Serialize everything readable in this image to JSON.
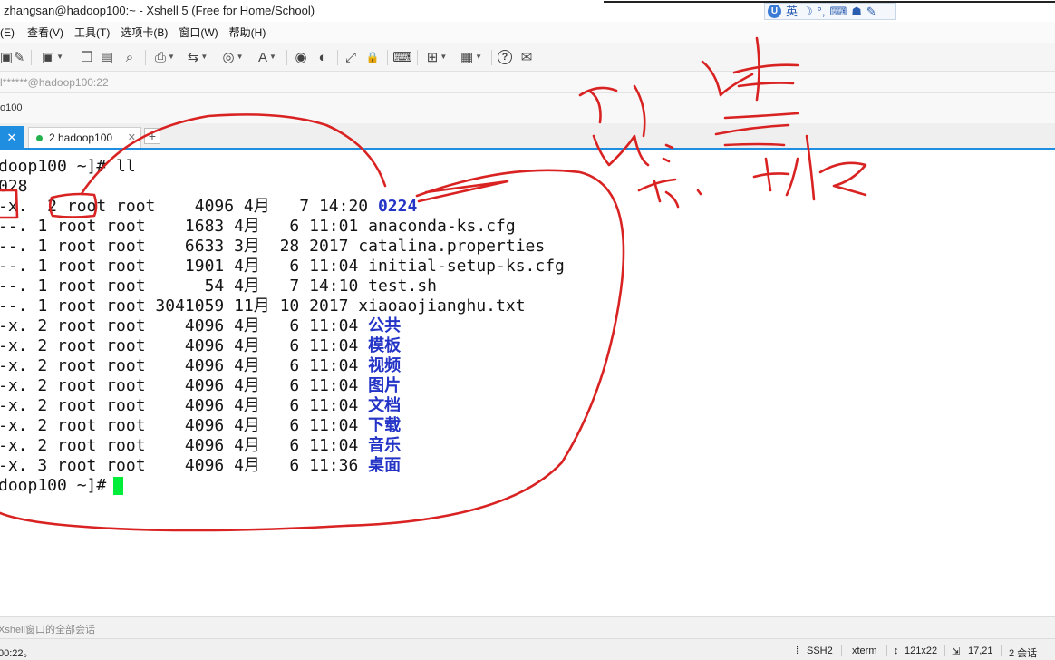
{
  "window": {
    "title": "zhangsan@hadoop100:~ - Xshell 5 (Free for Home/School)"
  },
  "ime": {
    "badge": "U",
    "lang": "英",
    "moon": "☽",
    "punct": "°,",
    "keyboard": "⌨",
    "user": "☗",
    "tools": "✎"
  },
  "menu": {
    "items": [
      "(E)",
      "查看(V)",
      "工具(T)",
      "选项卡(B)",
      "窗口(W)",
      "帮助(H)"
    ]
  },
  "toolbar": {
    "icons": [
      {
        "name": "new-session-icon",
        "glyph": "▣"
      },
      {
        "name": "properties-icon",
        "glyph": "✎"
      },
      {
        "name": "copy-icon",
        "glyph": "❐"
      },
      {
        "name": "paste-icon",
        "glyph": "▤"
      },
      {
        "name": "find-icon",
        "glyph": "⌕"
      },
      {
        "name": "print-icon",
        "glyph": "⎙"
      },
      {
        "name": "transfer-icon",
        "glyph": "⇆"
      },
      {
        "name": "globe-icon",
        "glyph": "◎"
      },
      {
        "name": "font-icon",
        "glyph": "A"
      },
      {
        "name": "xftp-icon",
        "glyph": "◉"
      },
      {
        "name": "xmanager-icon",
        "glyph": "◐"
      },
      {
        "name": "fullscreen-icon",
        "glyph": "⤢"
      },
      {
        "name": "lock-icon",
        "glyph": "🔒"
      },
      {
        "name": "keyboard-icon",
        "glyph": "⌨"
      },
      {
        "name": "new-tab-icon",
        "glyph": "⊞"
      },
      {
        "name": "layout-icon",
        "glyph": "▦"
      },
      {
        "name": "help-icon",
        "glyph": "?"
      },
      {
        "name": "chat-icon",
        "glyph": "✉"
      }
    ]
  },
  "address": {
    "text": "l******@hadoop100:22"
  },
  "session_bar": {
    "label": "o100"
  },
  "tabs": {
    "close_glyph": "✕",
    "session_label": "2 hadoop100",
    "session_close": "✕",
    "add_glyph": "+"
  },
  "terminal": {
    "lines": [
      {
        "text": "doop100 ~]# ll"
      },
      {
        "text": "028"
      },
      {
        "text": "-x.  2 root root    4096 4月   7 14:20 ",
        "name": "0224",
        "dir": true
      },
      {
        "text": "--. 1 root root    1683 4月   6 11:01 ",
        "name": "anaconda-ks.cfg",
        "dir": false
      },
      {
        "text": "--. 1 root root    6633 3月  28 2017 ",
        "name": "catalina.properties",
        "dir": false
      },
      {
        "text": "--. 1 root root    1901 4月   6 11:04 ",
        "name": "initial-setup-ks.cfg",
        "dir": false
      },
      {
        "text": "--. 1 root root      54 4月   7 14:10 ",
        "name": "test.sh",
        "dir": false
      },
      {
        "text": "--. 1 root root 3041059 11月 10 2017 ",
        "name": "xiaoaojianghu.txt",
        "dir": false
      },
      {
        "text": "-x. 2 root root    4096 4月   6 11:04 ",
        "name": "公共",
        "dir": true
      },
      {
        "text": "-x. 2 root root    4096 4月   6 11:04 ",
        "name": "模板",
        "dir": true
      },
      {
        "text": "-x. 2 root root    4096 4月   6 11:04 ",
        "name": "视频",
        "dir": true
      },
      {
        "text": "-x. 2 root root    4096 4月   6 11:04 ",
        "name": "图片",
        "dir": true
      },
      {
        "text": "-x. 2 root root    4096 4月   6 11:04 ",
        "name": "文档",
        "dir": true
      },
      {
        "text": "-x. 2 root root    4096 4月   6 11:04 ",
        "name": "下载",
        "dir": true
      },
      {
        "text": "-x. 2 root root    4096 4月   6 11:04 ",
        "name": "音乐",
        "dir": true
      },
      {
        "text": "-x. 3 root root    4096 4月   6 11:36 ",
        "name": "桌面",
        "dir": true
      },
      {
        "text": "doop100 ~]# "
      }
    ]
  },
  "hint": {
    "text": "Xshell窗口的全部会话"
  },
  "status": {
    "left": "00:22。",
    "protocol": "SSH2",
    "term": "xterm",
    "size": "121x22",
    "pos": "17,21",
    "sessions": "2 会话"
  },
  "colors": {
    "tab_accent": "#1f8ee0",
    "dir_text": "#2434c6",
    "cursor": "#00ee3a",
    "annotation_ink": "#d92222"
  }
}
